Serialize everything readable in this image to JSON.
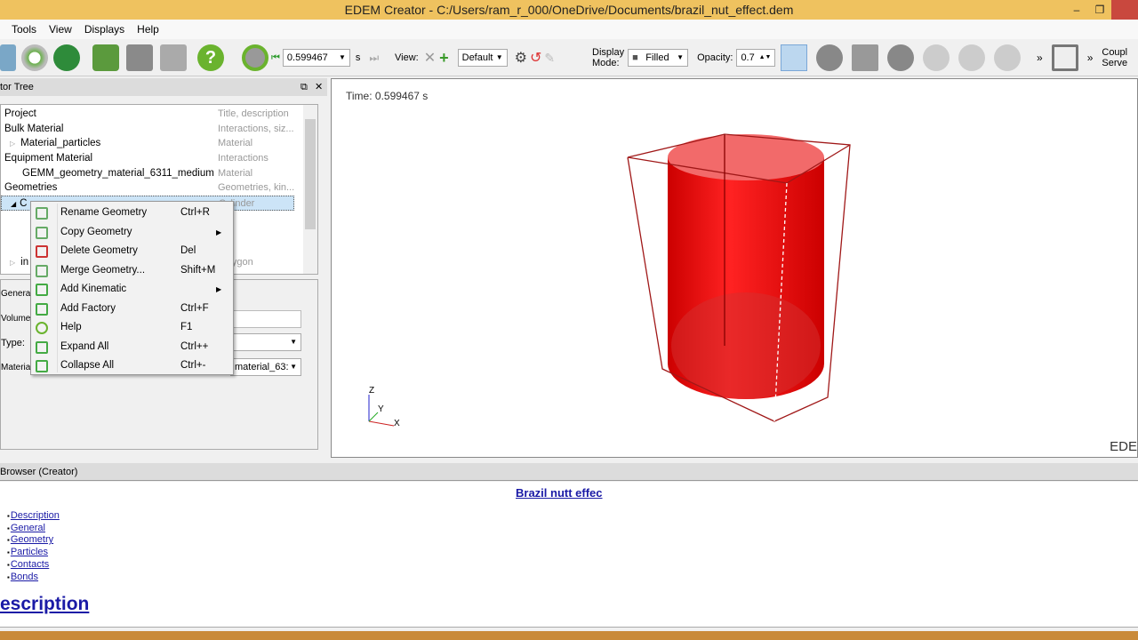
{
  "window": {
    "title": "EDEM Creator - C:/Users/ram_r_000/OneDrive/Documents/brazil_nut_effect.dem",
    "minimize": "–",
    "restore": "❐"
  },
  "menubar": [
    "Tools",
    "View",
    "Displays",
    "Help"
  ],
  "toolbar": {
    "time_value": "0.599467",
    "time_unit": "s",
    "view_label": "View:",
    "view_value": "Default",
    "display_mode_label1": "Display",
    "display_mode_label2": "Mode:",
    "display_mode_value": "Filled",
    "opacity_label": "Opacity:",
    "opacity_value": "0.7",
    "more": "»",
    "coupling1": "Coupl",
    "coupling2": "Serve"
  },
  "tree": {
    "title": "tor Tree",
    "rows": [
      {
        "name": "Project",
        "desc": "Title, description"
      },
      {
        "name": "Bulk Material",
        "desc": "Interactions, siz..."
      },
      {
        "name": "Material_particles",
        "desc": "Material"
      },
      {
        "name": "Equipment Material",
        "desc": "Interactions"
      },
      {
        "name": "GEMM_geometry_material_6311_medium",
        "desc": "Material"
      },
      {
        "name": "Geometries",
        "desc": "Geometries, kin..."
      },
      {
        "name": "C",
        "desc": "Cylinder"
      },
      {
        "name": "in",
        "desc": "Polygon"
      }
    ]
  },
  "props": {
    "general": "Genera",
    "volume": "Volume",
    "type": "Type:",
    "material": "Materia",
    "material_value": "material_63:"
  },
  "context_menu": [
    {
      "label": "Rename Geometry",
      "shortcut": "Ctrl+R",
      "icon": "rename-geometry-icon"
    },
    {
      "label": "Copy Geometry",
      "shortcut": "",
      "submenu": true,
      "icon": "copy-geometry-icon"
    },
    {
      "label": "Delete Geometry",
      "shortcut": "Del",
      "icon": "delete-geometry-icon"
    },
    {
      "label": "Merge Geometry...",
      "shortcut": "Shift+M",
      "icon": "merge-geometry-icon"
    },
    {
      "label": "Add Kinematic",
      "shortcut": "",
      "submenu": true,
      "icon": "add-kinematic-icon"
    },
    {
      "label": "Add Factory",
      "shortcut": "Ctrl+F",
      "icon": "add-factory-icon"
    },
    {
      "label": "Help",
      "shortcut": "F1",
      "icon": "help-icon"
    },
    {
      "label": "Expand All",
      "shortcut": "Ctrl++",
      "icon": "expand-all-icon"
    },
    {
      "label": "Collapse All",
      "shortcut": "Ctrl+-",
      "icon": "collapse-all-icon"
    }
  ],
  "viewport": {
    "time": "Time: 0.599467 s",
    "axis_z": "Z",
    "axis_y": "Y",
    "axis_x": "X",
    "logo": "EDE"
  },
  "browser": {
    "title": "Browser (Creator)",
    "heading": "Brazil nutt effec",
    "links": [
      "Description",
      "General",
      "Geometry",
      "Particles",
      "Contacts",
      "Bonds"
    ],
    "section": "escription"
  },
  "colors": {
    "accent": "#efc25f",
    "particles": "#e01010"
  }
}
